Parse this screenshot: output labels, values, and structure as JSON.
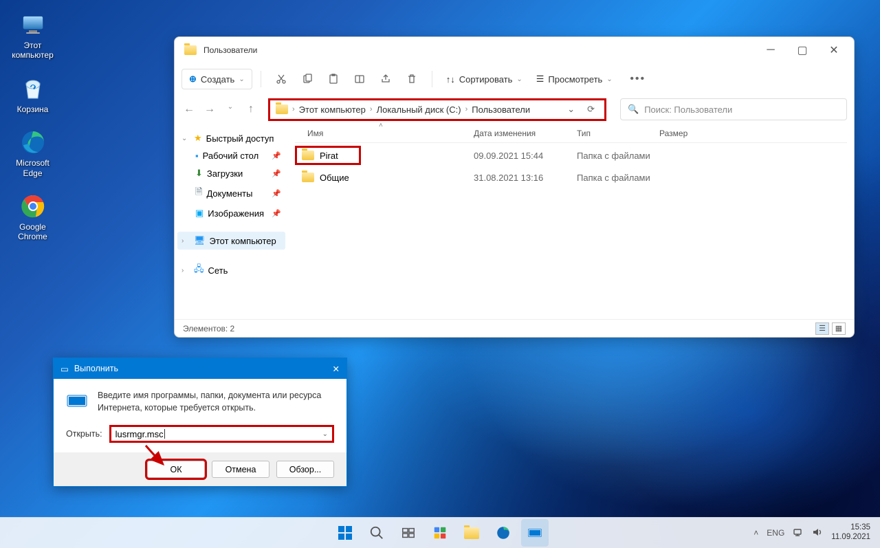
{
  "desktop": {
    "icons": [
      {
        "id": "this-pc",
        "label": "Этот\nкомпьютер"
      },
      {
        "id": "recycle-bin",
        "label": "Корзина"
      },
      {
        "id": "edge",
        "label": "Microsoft\nEdge"
      },
      {
        "id": "chrome",
        "label": "Google\nChrome"
      }
    ]
  },
  "explorer": {
    "title": "Пользователи",
    "toolbar": {
      "new": "Создать",
      "sort": "Сортировать",
      "view": "Просмотреть"
    },
    "breadcrumb": [
      "Этот компьютер",
      "Локальный диск (C:)",
      "Пользователи"
    ],
    "search_placeholder": "Поиск: Пользователи",
    "sidebar": {
      "quick": "Быстрый доступ",
      "items": [
        {
          "label": "Рабочий стол",
          "icon": "desktop"
        },
        {
          "label": "Загрузки",
          "icon": "downloads"
        },
        {
          "label": "Документы",
          "icon": "documents"
        },
        {
          "label": "Изображения",
          "icon": "pictures"
        }
      ],
      "this_pc": "Этот компьютер",
      "network": "Сеть"
    },
    "columns": {
      "name": "Имя",
      "date": "Дата изменения",
      "type": "Тип",
      "size": "Размер"
    },
    "rows": [
      {
        "name": "Pirat",
        "date": "09.09.2021 15:44",
        "type": "Папка с файлами",
        "highlight": true
      },
      {
        "name": "Общие",
        "date": "31.08.2021 13:16",
        "type": "Папка с файлами",
        "highlight": false
      }
    ],
    "status": "Элементов: 2"
  },
  "run": {
    "title": "Выполнить",
    "prompt": "Введите имя программы, папки, документа или ресурса Интернета, которые требуется открыть.",
    "open_label": "Открыть:",
    "value": "lusrmgr.msc",
    "ok": "ОК",
    "cancel": "Отмена",
    "browse": "Обзор..."
  },
  "taskbar": {
    "lang": "ENG",
    "time": "15:35",
    "date": "11.09.2021"
  }
}
